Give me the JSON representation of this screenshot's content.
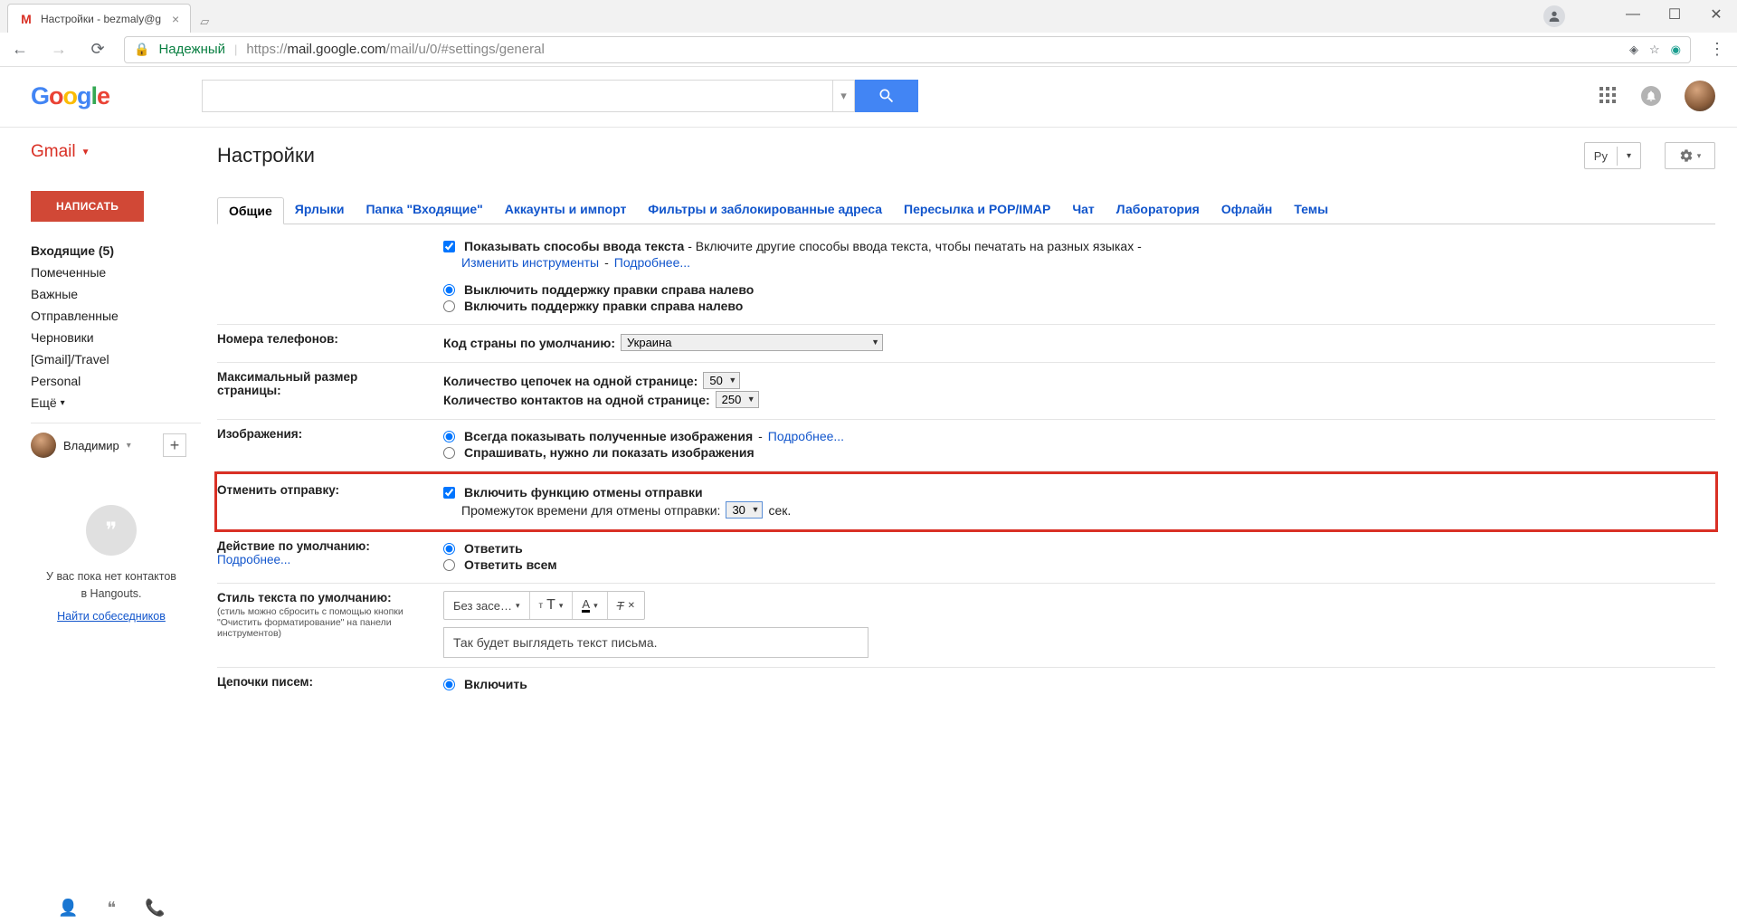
{
  "browser": {
    "tab_title": "Настройки - bezmaly@g",
    "security_label": "Надежный",
    "url_scheme": "https://",
    "url_host": "mail.google.com",
    "url_path": "/mail/u/0/#settings/general"
  },
  "header": {
    "apps_title": "Приложения Google",
    "notifications_title": "Уведомления"
  },
  "sidebar": {
    "brand": "Gmail",
    "compose": "НАПИСАТЬ",
    "items": [
      {
        "label": "Входящие (5)",
        "bold": true
      },
      {
        "label": "Помеченные"
      },
      {
        "label": "Важные"
      },
      {
        "label": "Отправленные"
      },
      {
        "label": "Черновики"
      },
      {
        "label": "[Gmail]/Travel"
      },
      {
        "label": "Personal"
      }
    ],
    "more": "Ещё",
    "profile_name": "Владимир",
    "hangouts_text1": "У вас пока нет контактов",
    "hangouts_text2": "в Hangouts.",
    "hangouts_link": "Найти собеседников"
  },
  "content": {
    "title": "Настройки",
    "lang_pill": "Ру",
    "tabs": [
      "Общие",
      "Ярлыки",
      "Папка \"Входящие\"",
      "Аккаунты и импорт",
      "Фильтры и заблокированные адреса",
      "Пересылка и POP/IMAP",
      "Чат",
      "Лаборатория",
      "Офлайн",
      "Темы"
    ]
  },
  "settings": {
    "input_methods": {
      "checkbox_label": "Показывать способы ввода текста",
      "desc": " - Включите другие способы ввода текста, чтобы печатать на разных языках - ",
      "link1": "Изменить инструменты",
      "sep": " - ",
      "link2": "Подробнее...",
      "rtl_off": "Выключить поддержку правки справа налево",
      "rtl_on": "Включить поддержку правки справа налево"
    },
    "phone": {
      "label": "Номера телефонов:",
      "field": "Код страны по умолчанию:",
      "value": "Украина"
    },
    "pagesize": {
      "label1": "Максимальный размер",
      "label2": "страницы:",
      "threads": "Количество цепочек на одной странице:",
      "threads_val": "50",
      "contacts": "Количество контактов на одной странице:",
      "contacts_val": "250"
    },
    "images": {
      "label": "Изображения:",
      "always": "Всегда показывать полученные изображения",
      "more": "Подробнее...",
      "ask": "Спрашивать, нужно ли показать изображения"
    },
    "undo": {
      "label": "Отменить отправку:",
      "enable": "Включить функцию отмены отправки",
      "interval_label": "Промежуток времени для отмены отправки:",
      "interval_val": "30",
      "interval_unit": "сек."
    },
    "default_action": {
      "label": "Действие по умолчанию:",
      "more": "Подробнее...",
      "reply": "Ответить",
      "reply_all": "Ответить всем"
    },
    "textstyle": {
      "label": "Стиль текста по умолчанию:",
      "sub": "(стиль можно сбросить с помощью кнопки \"Очистить форматирование\" на панели инструментов)",
      "font": "Без засе…",
      "sample": "Так будет выглядеть текст письма."
    },
    "threads": {
      "label": "Цепочки писем:",
      "on": "Включить"
    }
  }
}
